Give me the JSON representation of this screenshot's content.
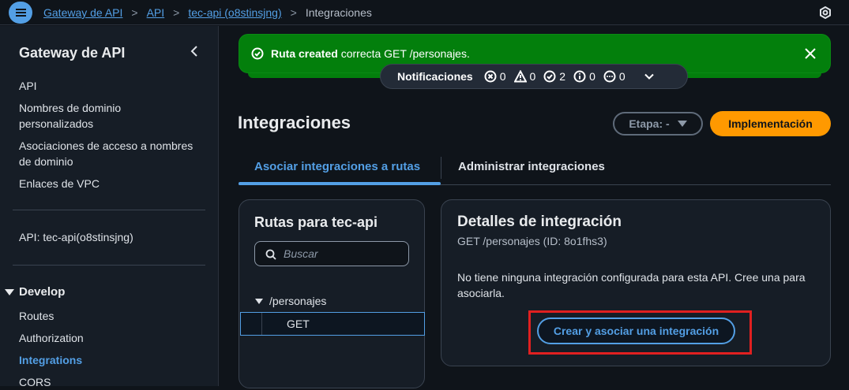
{
  "header": {
    "breadcrumb": [
      "Gateway de API",
      "API",
      "tec-api (o8stinsjng)"
    ],
    "current": "Integraciones"
  },
  "sidebar": {
    "title": "Gateway de API",
    "items": [
      "API",
      "Nombres de dominio personalizados",
      "Asociaciones de acceso a nombres de dominio",
      "Enlaces de VPC"
    ],
    "api_label": "API: tec-api(o8stinsjng)",
    "section": "Develop",
    "develop_items": [
      "Routes",
      "Authorization",
      "Integrations",
      "CORS"
    ],
    "active_item": "Integrations"
  },
  "flash": {
    "bold": "Ruta created",
    "text": " correcta GET /personajes."
  },
  "notifications": {
    "label": "Notificaciones",
    "errors": "0",
    "warnings": "0",
    "success": "2",
    "info": "0",
    "in_progress": "0"
  },
  "main": {
    "title": "Integraciones",
    "stage_label": "Etapa: -",
    "deploy_label": "Implementación",
    "tabs": [
      "Asociar integraciones a rutas",
      "Administrar integraciones"
    ]
  },
  "routes": {
    "title": "Rutas para tec-api",
    "search_placeholder": "Buscar",
    "path": "/personajes",
    "method": "GET"
  },
  "details": {
    "title": "Detalles de integración",
    "subtitle": "GET /personajes (ID: 8o1fhs3)",
    "message": "No tiene ninguna integración configurada para esta API. Cree una para asociarla.",
    "button": "Crear y asociar una integración"
  },
  "colors": {
    "accent": "#539fe5",
    "success": "#037f0c",
    "deploy": "#ff9900",
    "highlight": "#e02020"
  }
}
